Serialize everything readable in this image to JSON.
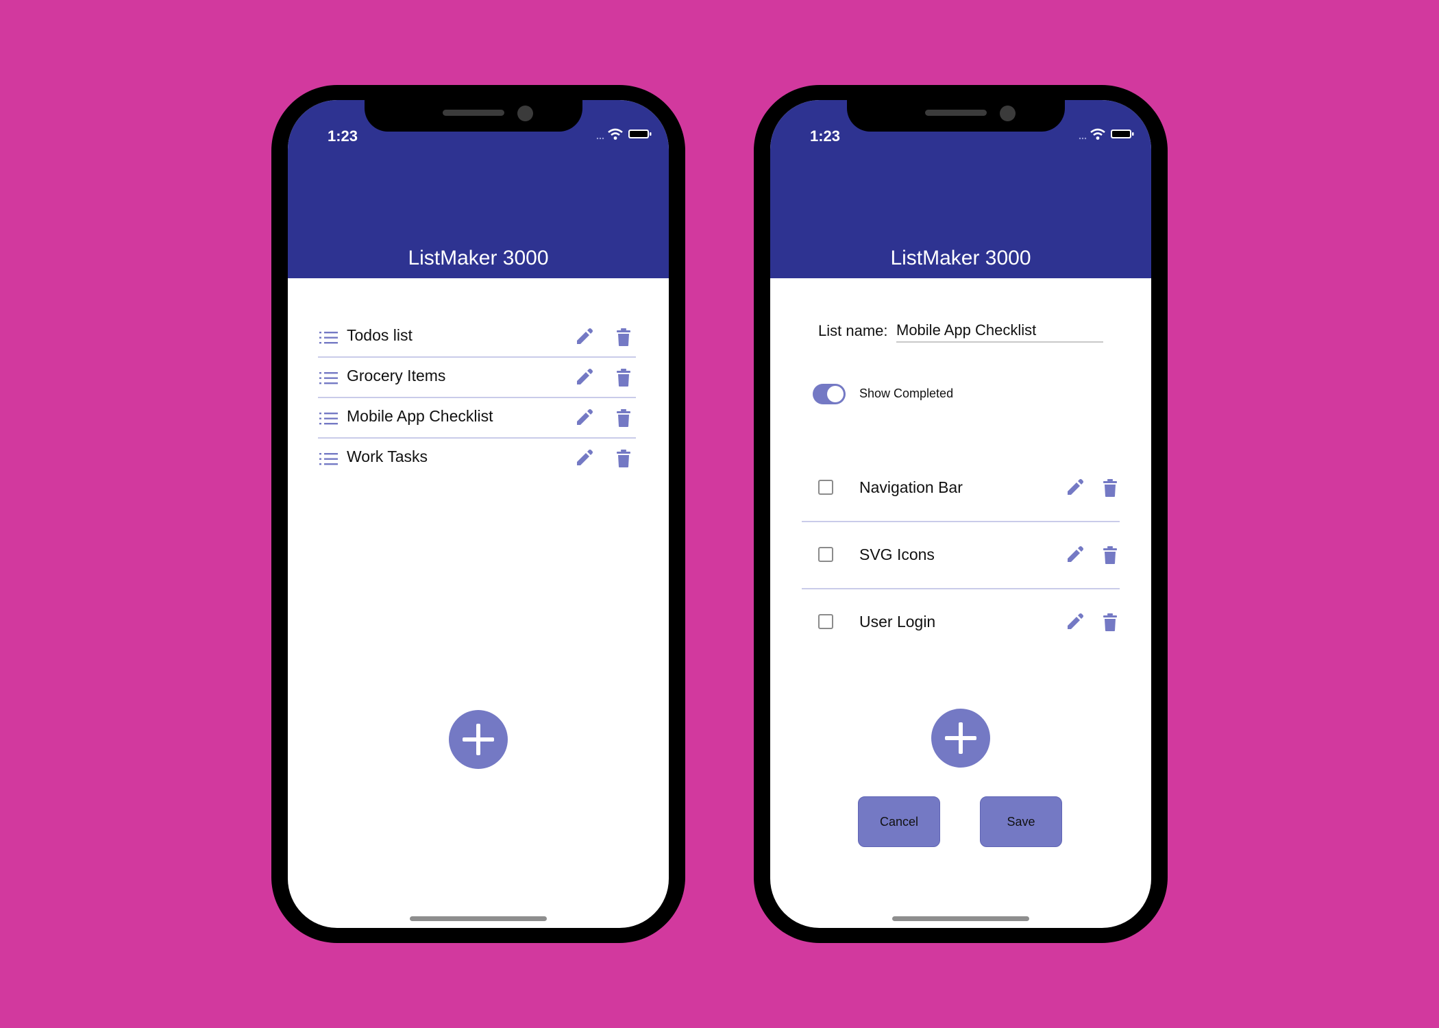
{
  "colors": {
    "background": "#d2399e",
    "header": "#2e3391",
    "accent": "#7479c4",
    "divider": "#c9cbe9"
  },
  "left_phone": {
    "status": {
      "time": "1:23"
    },
    "header": {
      "title": "ListMaker 3000"
    },
    "lists": [
      {
        "label": "Todos list",
        "icon": "list-icon",
        "actions": [
          "edit-icon",
          "trash-icon"
        ]
      },
      {
        "label": "Grocery Items",
        "icon": "list-icon",
        "actions": [
          "edit-icon",
          "trash-icon"
        ]
      },
      {
        "label": "Mobile App Checklist",
        "icon": "list-icon",
        "actions": [
          "edit-icon",
          "trash-icon"
        ]
      },
      {
        "label": "Work Tasks",
        "icon": "list-icon",
        "actions": [
          "edit-icon",
          "trash-icon"
        ]
      }
    ],
    "fab_icon": "plus-icon"
  },
  "right_phone": {
    "status": {
      "time": "1:23"
    },
    "header": {
      "title": "ListMaker 3000"
    },
    "form": {
      "list_name_label": "List name:",
      "list_name_value": "Mobile App Checklist",
      "show_completed_label": "Show Completed",
      "show_completed_on": true
    },
    "items": [
      {
        "label": "Navigation Bar",
        "checked": false
      },
      {
        "label": "SVG Icons",
        "checked": false
      },
      {
        "label": "User Login",
        "checked": false
      }
    ],
    "fab_icon": "plus-icon",
    "buttons": {
      "cancel": "Cancel",
      "save": "Save"
    }
  }
}
